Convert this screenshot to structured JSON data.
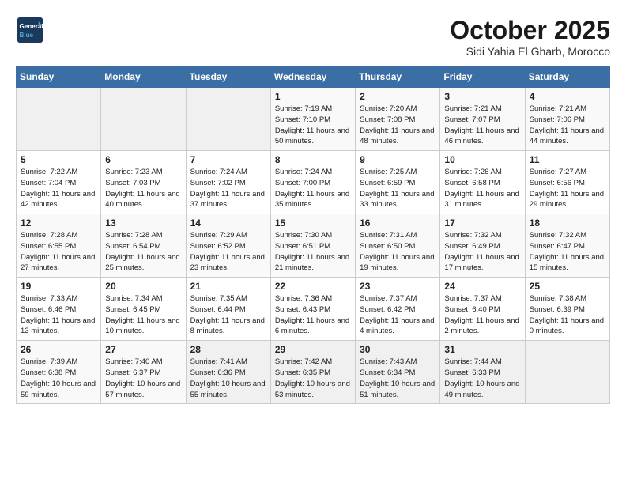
{
  "header": {
    "logo_line1": "General",
    "logo_line2": "Blue",
    "month": "October 2025",
    "location": "Sidi Yahia El Gharb, Morocco"
  },
  "weekdays": [
    "Sunday",
    "Monday",
    "Tuesday",
    "Wednesday",
    "Thursday",
    "Friday",
    "Saturday"
  ],
  "weeks": [
    [
      {
        "day": "",
        "info": ""
      },
      {
        "day": "",
        "info": ""
      },
      {
        "day": "",
        "info": ""
      },
      {
        "day": "1",
        "info": "Sunrise: 7:19 AM\nSunset: 7:10 PM\nDaylight: 11 hours and 50 minutes."
      },
      {
        "day": "2",
        "info": "Sunrise: 7:20 AM\nSunset: 7:08 PM\nDaylight: 11 hours and 48 minutes."
      },
      {
        "day": "3",
        "info": "Sunrise: 7:21 AM\nSunset: 7:07 PM\nDaylight: 11 hours and 46 minutes."
      },
      {
        "day": "4",
        "info": "Sunrise: 7:21 AM\nSunset: 7:06 PM\nDaylight: 11 hours and 44 minutes."
      }
    ],
    [
      {
        "day": "5",
        "info": "Sunrise: 7:22 AM\nSunset: 7:04 PM\nDaylight: 11 hours and 42 minutes."
      },
      {
        "day": "6",
        "info": "Sunrise: 7:23 AM\nSunset: 7:03 PM\nDaylight: 11 hours and 40 minutes."
      },
      {
        "day": "7",
        "info": "Sunrise: 7:24 AM\nSunset: 7:02 PM\nDaylight: 11 hours and 37 minutes."
      },
      {
        "day": "8",
        "info": "Sunrise: 7:24 AM\nSunset: 7:00 PM\nDaylight: 11 hours and 35 minutes."
      },
      {
        "day": "9",
        "info": "Sunrise: 7:25 AM\nSunset: 6:59 PM\nDaylight: 11 hours and 33 minutes."
      },
      {
        "day": "10",
        "info": "Sunrise: 7:26 AM\nSunset: 6:58 PM\nDaylight: 11 hours and 31 minutes."
      },
      {
        "day": "11",
        "info": "Sunrise: 7:27 AM\nSunset: 6:56 PM\nDaylight: 11 hours and 29 minutes."
      }
    ],
    [
      {
        "day": "12",
        "info": "Sunrise: 7:28 AM\nSunset: 6:55 PM\nDaylight: 11 hours and 27 minutes."
      },
      {
        "day": "13",
        "info": "Sunrise: 7:28 AM\nSunset: 6:54 PM\nDaylight: 11 hours and 25 minutes."
      },
      {
        "day": "14",
        "info": "Sunrise: 7:29 AM\nSunset: 6:52 PM\nDaylight: 11 hours and 23 minutes."
      },
      {
        "day": "15",
        "info": "Sunrise: 7:30 AM\nSunset: 6:51 PM\nDaylight: 11 hours and 21 minutes."
      },
      {
        "day": "16",
        "info": "Sunrise: 7:31 AM\nSunset: 6:50 PM\nDaylight: 11 hours and 19 minutes."
      },
      {
        "day": "17",
        "info": "Sunrise: 7:32 AM\nSunset: 6:49 PM\nDaylight: 11 hours and 17 minutes."
      },
      {
        "day": "18",
        "info": "Sunrise: 7:32 AM\nSunset: 6:47 PM\nDaylight: 11 hours and 15 minutes."
      }
    ],
    [
      {
        "day": "19",
        "info": "Sunrise: 7:33 AM\nSunset: 6:46 PM\nDaylight: 11 hours and 13 minutes."
      },
      {
        "day": "20",
        "info": "Sunrise: 7:34 AM\nSunset: 6:45 PM\nDaylight: 11 hours and 10 minutes."
      },
      {
        "day": "21",
        "info": "Sunrise: 7:35 AM\nSunset: 6:44 PM\nDaylight: 11 hours and 8 minutes."
      },
      {
        "day": "22",
        "info": "Sunrise: 7:36 AM\nSunset: 6:43 PM\nDaylight: 11 hours and 6 minutes."
      },
      {
        "day": "23",
        "info": "Sunrise: 7:37 AM\nSunset: 6:42 PM\nDaylight: 11 hours and 4 minutes."
      },
      {
        "day": "24",
        "info": "Sunrise: 7:37 AM\nSunset: 6:40 PM\nDaylight: 11 hours and 2 minutes."
      },
      {
        "day": "25",
        "info": "Sunrise: 7:38 AM\nSunset: 6:39 PM\nDaylight: 11 hours and 0 minutes."
      }
    ],
    [
      {
        "day": "26",
        "info": "Sunrise: 7:39 AM\nSunset: 6:38 PM\nDaylight: 10 hours and 59 minutes."
      },
      {
        "day": "27",
        "info": "Sunrise: 7:40 AM\nSunset: 6:37 PM\nDaylight: 10 hours and 57 minutes."
      },
      {
        "day": "28",
        "info": "Sunrise: 7:41 AM\nSunset: 6:36 PM\nDaylight: 10 hours and 55 minutes."
      },
      {
        "day": "29",
        "info": "Sunrise: 7:42 AM\nSunset: 6:35 PM\nDaylight: 10 hours and 53 minutes."
      },
      {
        "day": "30",
        "info": "Sunrise: 7:43 AM\nSunset: 6:34 PM\nDaylight: 10 hours and 51 minutes."
      },
      {
        "day": "31",
        "info": "Sunrise: 7:44 AM\nSunset: 6:33 PM\nDaylight: 10 hours and 49 minutes."
      },
      {
        "day": "",
        "info": ""
      }
    ]
  ]
}
